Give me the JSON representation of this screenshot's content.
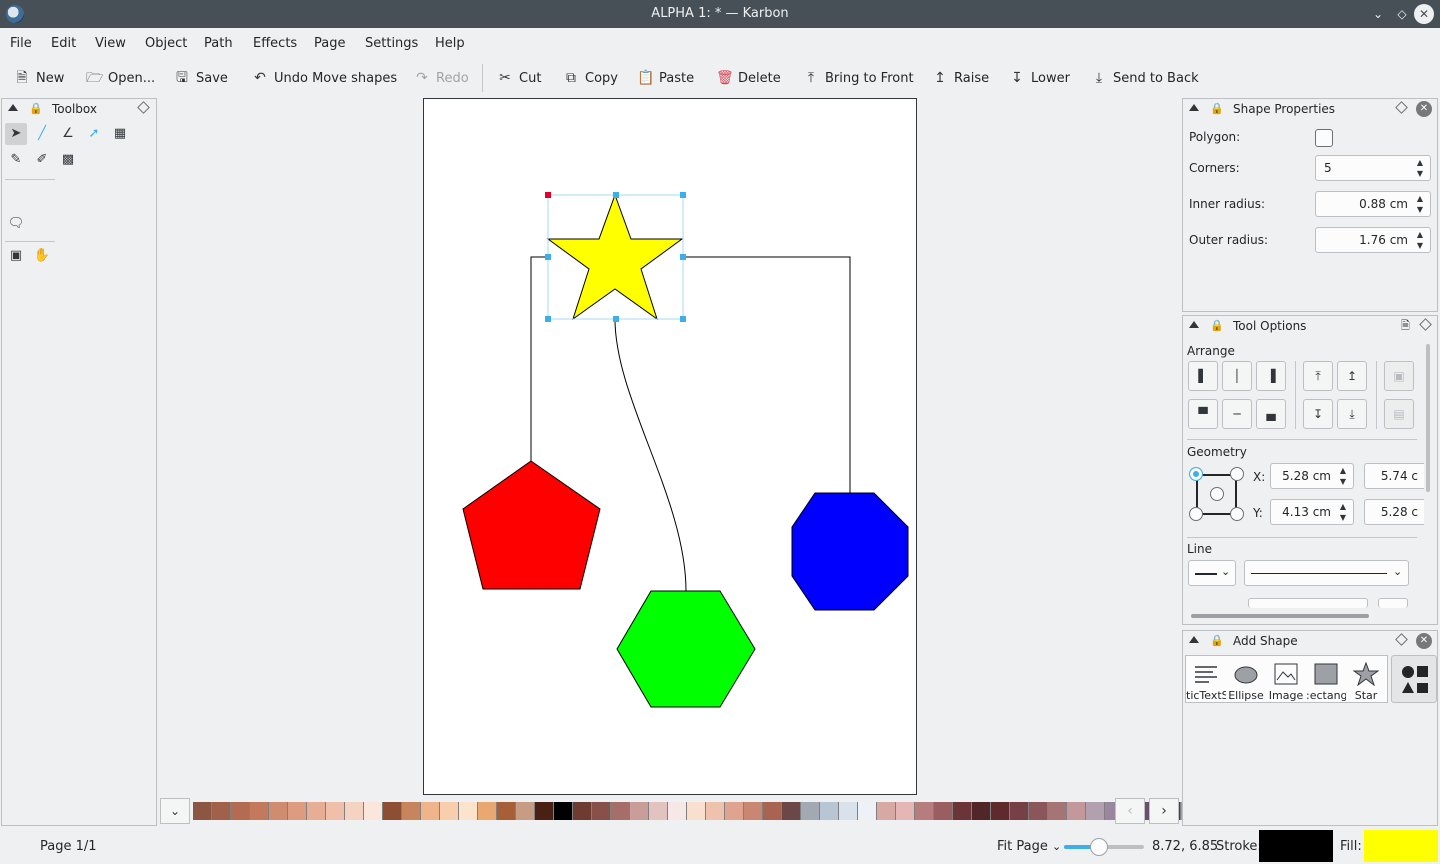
{
  "window": {
    "title": "ALPHA 1: * — Karbon"
  },
  "menu": [
    "File",
    "Edit",
    "View",
    "Object",
    "Path",
    "Effects",
    "Page",
    "Settings",
    "Help"
  ],
  "toolbar": {
    "new": "New",
    "open": "Open...",
    "save": "Save",
    "undo": "Undo Move shapes",
    "redo": "Redo",
    "cut": "Cut",
    "copy": "Copy",
    "paste": "Paste",
    "delete": "Delete",
    "bring_to_front": "Bring to Front",
    "raise": "Raise",
    "lower": "Lower",
    "send_to_back": "Send to Back"
  },
  "toolbox": {
    "title": "Toolbox"
  },
  "shape_properties": {
    "title": "Shape Properties",
    "polygon_label": "Polygon:",
    "polygon_checked": false,
    "corners_label": "Corners:",
    "corners_value": "5",
    "inner_radius_label": "Inner radius:",
    "inner_radius_value": "0.88 cm",
    "outer_radius_label": "Outer radius:",
    "outer_radius_value": "1.76 cm"
  },
  "tool_options": {
    "title": "Tool Options",
    "arrange_label": "Arrange",
    "geometry_label": "Geometry",
    "x_label": "X:",
    "x_value": "5.28 cm",
    "width_value": "5.74 c",
    "y_label": "Y:",
    "y_value": "4.13 cm",
    "height_value": "5.28 c",
    "line_label": "Line"
  },
  "add_shape": {
    "title": "Add Shape",
    "items": [
      "ticTextSl",
      "Ellipse",
      "Image",
      ":ectangl",
      "Star"
    ]
  },
  "palette": {
    "colors": [
      "#8b5742",
      "#a0604a",
      "#b36b52",
      "#c4795c",
      "#d08c6e",
      "#dd9c80",
      "#e8ae95",
      "#efbfa9",
      "#f5d3c3",
      "#fbe6dc",
      "#8e4e33",
      "#c8845a",
      "#f0b48a",
      "#f7cfad",
      "#fbe3cc",
      "#e8a870",
      "#a65f37",
      "#c69c83",
      "#4a1f14",
      "#000000",
      "#6e3b30",
      "#875049",
      "#a56e69",
      "#c99e9a",
      "#e2c3c0",
      "#f6e8e6",
      "#f9dfcf",
      "#efc2ae",
      "#e0a38f",
      "#c98673",
      "#a96351",
      "#6b4748",
      "#a3a9b2",
      "#b8c5d3",
      "#d9e2ec",
      "#eef2f7",
      "#d8a8a5",
      "#e4b7b5",
      "#b77c7d",
      "#9a5d60",
      "#6b3436",
      "#512628",
      "#5e2a2e",
      "#774046",
      "#8a5659",
      "#a57475",
      "#c2989a",
      "#b1a0b0",
      "#9b86a0",
      "#7f6a88",
      "#6a4f6c",
      "#5a3a4e",
      "#c7928d"
    ]
  },
  "status": {
    "page": "Page 1/1",
    "zoom": "Fit Page",
    "coords": "8.72, 6.85",
    "stroke_label": "Stroke:",
    "fill_label": "Fill:",
    "stroke_color": "#000000",
    "fill_color": "#ffff00"
  },
  "accent_color": "#3daee9"
}
